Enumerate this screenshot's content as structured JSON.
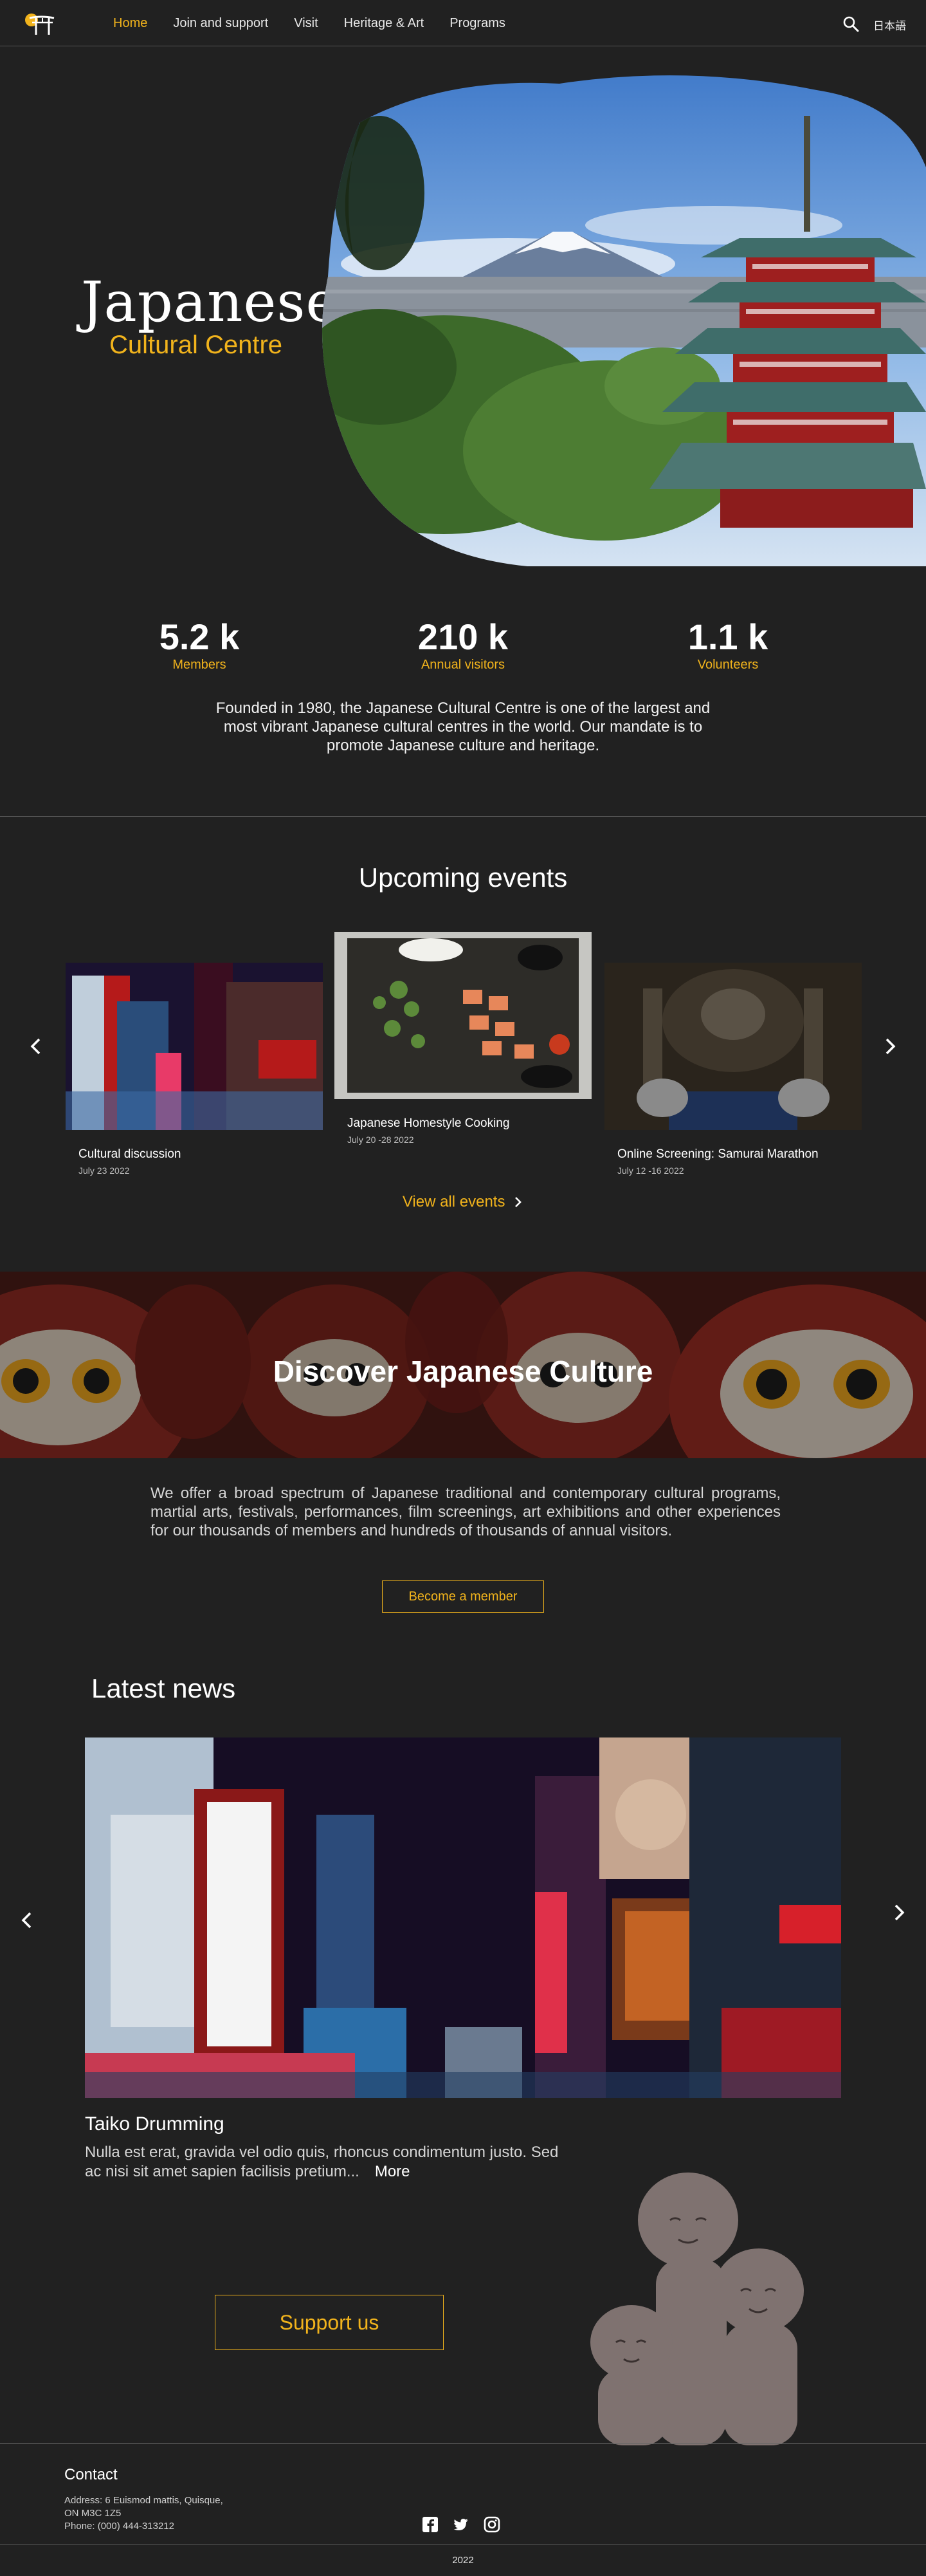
{
  "nav": {
    "links": [
      "Home",
      "Join and support",
      "Visit",
      "Heritage & Art",
      "Programs"
    ],
    "lang": "日本語",
    "active_color": "#f1b31c",
    "search_icon": "search-icon"
  },
  "hero": {
    "title": "Japanese",
    "subtitle": "Cultural Centre"
  },
  "stats": [
    {
      "value": "5.2 k",
      "label": "Members"
    },
    {
      "value": "210 k",
      "label": "Annual visitors"
    },
    {
      "value": "1.1 k",
      "label": "Volunteers"
    }
  ],
  "about": "Founded in 1980, the Japanese Cultural Centre is one of the largest and most vibrant Japanese cultural centres in the world. Our mandate is to promote Japanese culture and heritage.",
  "events": {
    "title": "Upcoming events",
    "items": [
      {
        "name": "Cultural discussion",
        "date": "July 23 2022"
      },
      {
        "name": "Japanese Homestyle Cooking",
        "date": "July 20 -28 2022"
      },
      {
        "name": "Online Screening: Samurai Marathon",
        "date": "July 12 -16 2022"
      }
    ],
    "view_all": "View all events"
  },
  "discover": {
    "title": "Discover Japanese Culture",
    "text": "We offer a broad spectrum of Japanese traditional and contemporary cultural programs, martial arts, festivals, performances, film screenings, art exhibitions and other experiences for our thousands of members and hundreds of thousands of annual visitors.",
    "cta": "Become a member"
  },
  "news": {
    "title": "Latest news",
    "headline": "Taiko Drumming",
    "body": "Nulla est erat, gravida vel odio quis, rhoncus condimentum justo. Sed ac nisi sit amet sapien facilisis pretium...",
    "more": "More"
  },
  "support": {
    "cta": "Support us"
  },
  "footer": {
    "contact_title": "Contact",
    "address_line1": "Address: 6 Euismod mattis, Quisque,",
    "address_line2": "ON M3C 1Z5",
    "phone": "Phone: (000) 444-313212",
    "socials": [
      "facebook-icon",
      "twitter-icon",
      "instagram-icon"
    ],
    "copyright": "2022"
  },
  "colors": {
    "accent": "#f1b31c",
    "background": "#212121"
  }
}
